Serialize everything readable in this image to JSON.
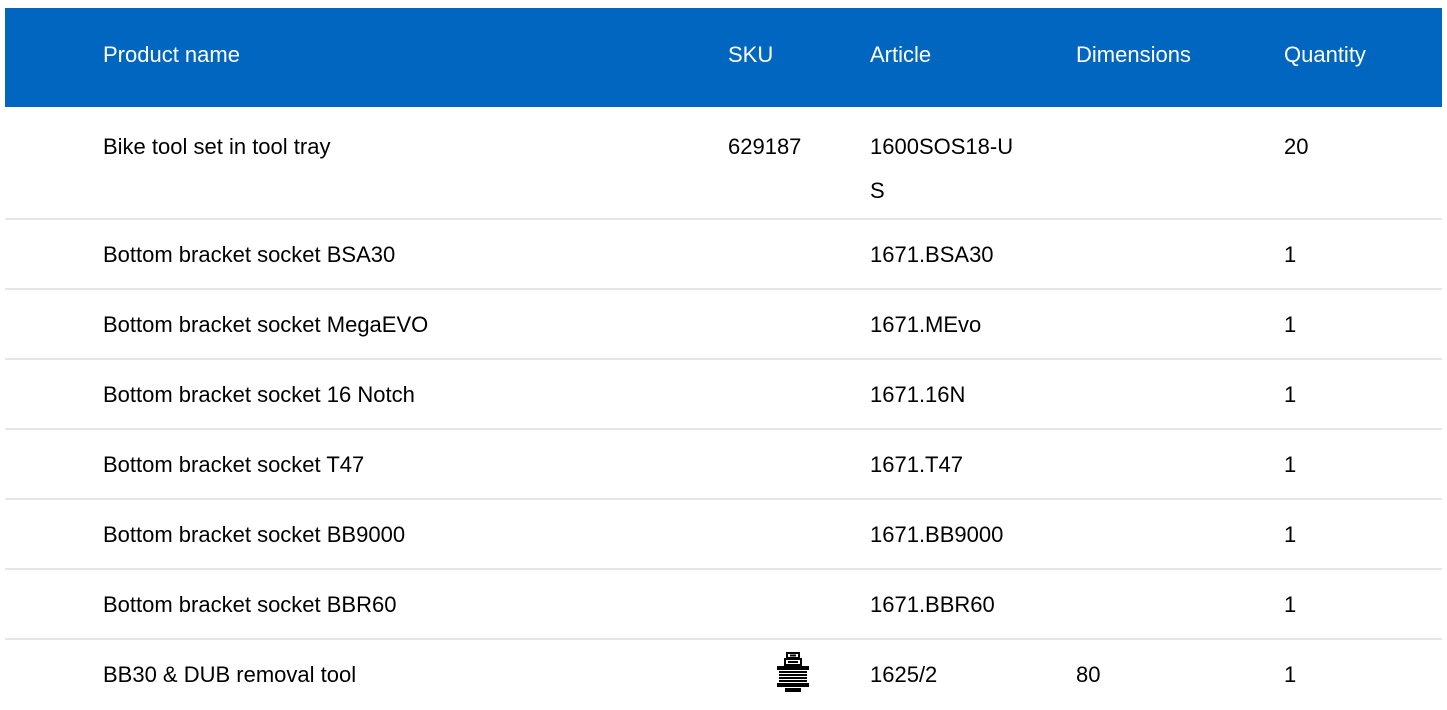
{
  "table": {
    "headers": {
      "name": "Product name",
      "sku": "SKU",
      "article": "Article",
      "dimensions": "Dimensions",
      "quantity": "Quantity"
    },
    "rows": [
      {
        "name": "Bike tool set in tool tray",
        "sku": "629187",
        "article": "1600SOS18-US",
        "dimensions": "",
        "quantity": "20"
      },
      {
        "name": "Bottom bracket socket BSA30",
        "sku": "",
        "article": "1671.BSA30",
        "dimensions": "",
        "quantity": "1"
      },
      {
        "name": "Bottom bracket socket MegaEVO",
        "sku": "",
        "article": "1671.MEvo",
        "dimensions": "",
        "quantity": "1"
      },
      {
        "name": "Bottom bracket socket 16 Notch",
        "sku": "",
        "article": "1671.16N",
        "dimensions": "",
        "quantity": "1"
      },
      {
        "name": "Bottom bracket socket T47",
        "sku": "",
        "article": "1671.T47",
        "dimensions": "",
        "quantity": "1"
      },
      {
        "name": "Bottom bracket socket BB9000",
        "sku": "",
        "article": "1671.BB9000",
        "dimensions": "",
        "quantity": "1"
      },
      {
        "name": "Bottom bracket socket BBR60",
        "sku": "",
        "article": "1671.BBR60",
        "dimensions": "",
        "quantity": "1"
      },
      {
        "name": "BB30 & DUB removal tool",
        "sku_icon": "removal-tool-icon",
        "article": "1625/2",
        "dimensions": "80",
        "quantity": "1"
      }
    ]
  },
  "colors": {
    "header_bg": "#0066bf",
    "header_text": "#ffffff",
    "row_divider": "#e6e6e6"
  }
}
